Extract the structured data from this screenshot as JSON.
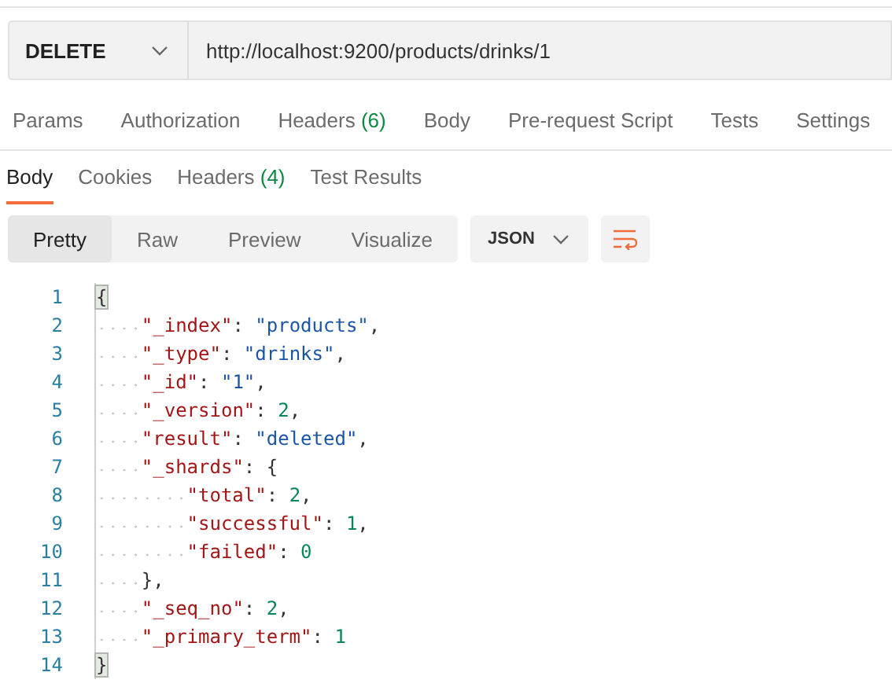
{
  "request": {
    "method": "DELETE",
    "url": "http://localhost:9200/products/drinks/1"
  },
  "request_tabs": [
    {
      "label": "Params"
    },
    {
      "label": "Authorization"
    },
    {
      "label": "Headers",
      "count": "(6)"
    },
    {
      "label": "Body"
    },
    {
      "label": "Pre-request Script"
    },
    {
      "label": "Tests"
    },
    {
      "label": "Settings"
    }
  ],
  "response_tabs": [
    {
      "label": "Body",
      "selected": true
    },
    {
      "label": "Cookies",
      "selected": false
    },
    {
      "label": "Headers",
      "count": "(4)",
      "selected": false
    },
    {
      "label": "Test Results",
      "selected": false
    }
  ],
  "view_modes": [
    {
      "label": "Pretty",
      "selected": true
    },
    {
      "label": "Raw",
      "selected": false
    },
    {
      "label": "Preview",
      "selected": false
    },
    {
      "label": "Visualize",
      "selected": false
    }
  ],
  "format": "JSON",
  "code": [
    {
      "number": "1",
      "tokens": [
        {
          "kind": "matched-brace",
          "text": "{"
        }
      ],
      "children": [
        {
          "number": "2",
          "tokens": [
            {
              "kind": "key",
              "text": "\"_index\""
            },
            {
              "kind": "punct",
              "text": ": "
            },
            {
              "kind": "string",
              "text": "\"products\""
            },
            {
              "kind": "punct",
              "text": ","
            }
          ]
        },
        {
          "number": "3",
          "tokens": [
            {
              "kind": "key",
              "text": "\"_type\""
            },
            {
              "kind": "punct",
              "text": ": "
            },
            {
              "kind": "string",
              "text": "\"drinks\""
            },
            {
              "kind": "punct",
              "text": ","
            }
          ]
        },
        {
          "number": "4",
          "tokens": [
            {
              "kind": "key",
              "text": "\"_id\""
            },
            {
              "kind": "punct",
              "text": ": "
            },
            {
              "kind": "string",
              "text": "\"1\""
            },
            {
              "kind": "punct",
              "text": ","
            }
          ]
        },
        {
          "number": "5",
          "tokens": [
            {
              "kind": "key",
              "text": "\"_version\""
            },
            {
              "kind": "punct",
              "text": ": "
            },
            {
              "kind": "number",
              "text": "2"
            },
            {
              "kind": "punct",
              "text": ","
            }
          ]
        },
        {
          "number": "6",
          "tokens": [
            {
              "kind": "key",
              "text": "\"result\""
            },
            {
              "kind": "punct",
              "text": ": "
            },
            {
              "kind": "string",
              "text": "\"deleted\""
            },
            {
              "kind": "punct",
              "text": ","
            }
          ]
        },
        {
          "number": "7",
          "tokens": [
            {
              "kind": "key",
              "text": "\"_shards\""
            },
            {
              "kind": "punct",
              "text": ": {"
            }
          ],
          "children": [
            {
              "number": "8",
              "tokens": [
                {
                  "kind": "key",
                  "text": "\"total\""
                },
                {
                  "kind": "punct",
                  "text": ": "
                },
                {
                  "kind": "number",
                  "text": "2"
                },
                {
                  "kind": "punct",
                  "text": ","
                }
              ]
            },
            {
              "number": "9",
              "tokens": [
                {
                  "kind": "key",
                  "text": "\"successful\""
                },
                {
                  "kind": "punct",
                  "text": ": "
                },
                {
                  "kind": "number",
                  "text": "1"
                },
                {
                  "kind": "punct",
                  "text": ","
                }
              ]
            },
            {
              "number": "10",
              "tokens": [
                {
                  "kind": "key",
                  "text": "\"failed\""
                },
                {
                  "kind": "punct",
                  "text": ": "
                },
                {
                  "kind": "number",
                  "text": "0"
                }
              ]
            }
          ]
        },
        {
          "number": "11",
          "tokens": [
            {
              "kind": "punct",
              "text": "},"
            }
          ]
        },
        {
          "number": "12",
          "tokens": [
            {
              "kind": "key",
              "text": "\"_seq_no\""
            },
            {
              "kind": "punct",
              "text": ": "
            },
            {
              "kind": "number",
              "text": "2"
            },
            {
              "kind": "punct",
              "text": ","
            }
          ]
        },
        {
          "number": "13",
          "tokens": [
            {
              "kind": "key",
              "text": "\"_primary_term\""
            },
            {
              "kind": "punct",
              "text": ": "
            },
            {
              "kind": "number",
              "text": "1"
            }
          ]
        }
      ]
    },
    {
      "number": "14",
      "tokens": [
        {
          "kind": "matched-brace",
          "text": "}"
        }
      ]
    }
  ]
}
